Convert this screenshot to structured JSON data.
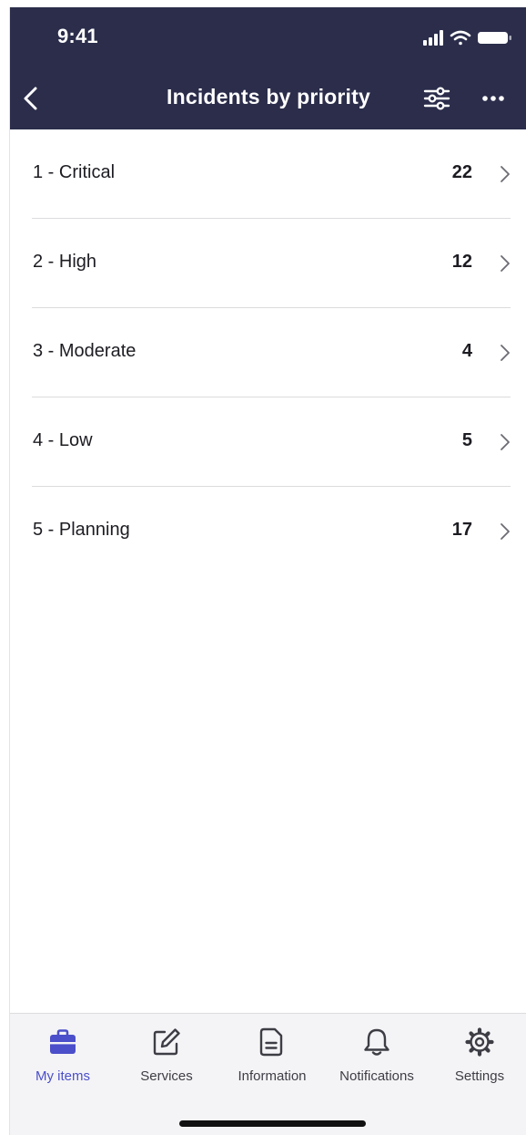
{
  "status_bar": {
    "time": "9:41"
  },
  "header": {
    "title": "Incidents by priority"
  },
  "priorities": [
    {
      "label": "1 - Critical",
      "count": "22"
    },
    {
      "label": "2 - High",
      "count": "12"
    },
    {
      "label": "3 - Moderate",
      "count": "4"
    },
    {
      "label": "4 - Low",
      "count": "5"
    },
    {
      "label": "5 - Planning",
      "count": "17"
    }
  ],
  "tabbar": {
    "tabs": [
      {
        "label": "My items",
        "icon": "briefcase-icon",
        "active": true
      },
      {
        "label": "Services",
        "icon": "edit-icon",
        "active": false
      },
      {
        "label": "Information",
        "icon": "document-icon",
        "active": false
      },
      {
        "label": "Notifications",
        "icon": "bell-icon",
        "active": false
      },
      {
        "label": "Settings",
        "icon": "gear-icon",
        "active": false
      }
    ]
  },
  "colors": {
    "header_bg": "#2b2d4b",
    "accent": "#4b4fc9",
    "tabbar_bg": "#f4f4f6"
  }
}
